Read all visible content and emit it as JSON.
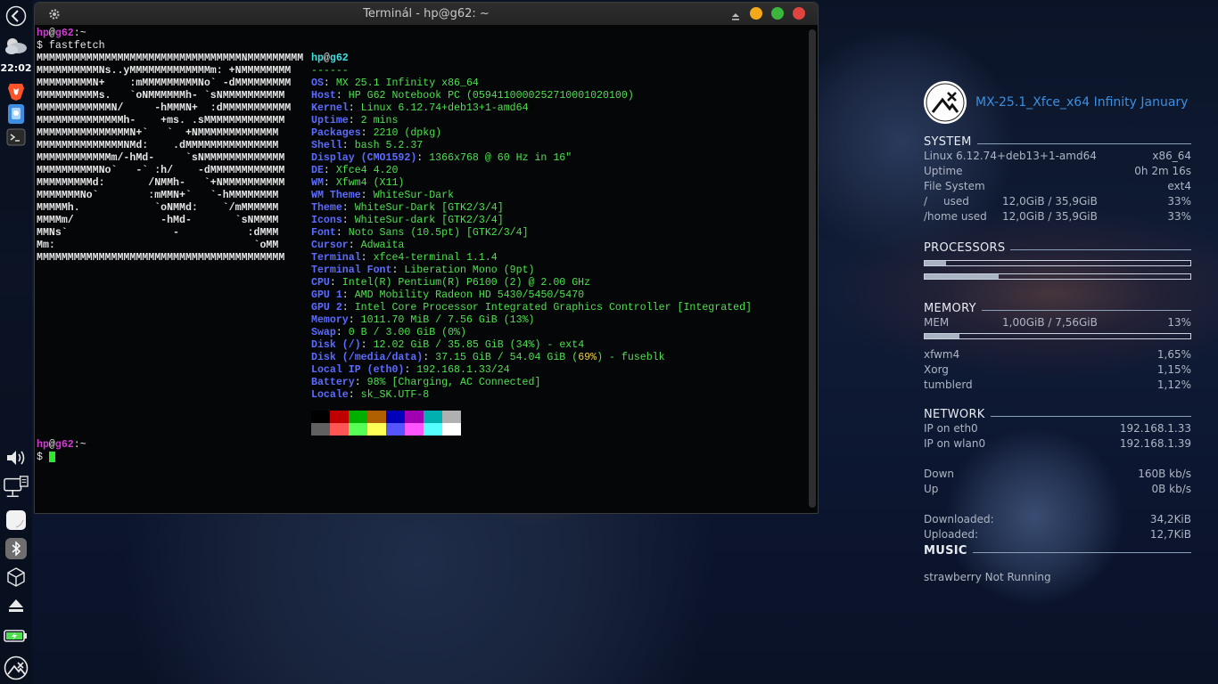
{
  "window": {
    "title": "Terminál - hp@g62: ~"
  },
  "panel": {
    "clock": "22:02"
  },
  "terminal": {
    "prompt1": {
      "user": "hp",
      "at": "@",
      "host": "g62",
      "path": ":~"
    },
    "command": "$ fastfetch",
    "logo_lines": [
      "MMMMMMMMMMMMMMMMMMMMMMMMMMMMMMMMMNMMMMMMMMM",
      "MMMMMMMMMMNs..yMMMMMMMMMMMMMm: +NMMMMMMMM",
      "MMMMMMMMMN+    :mMMMMMMMMMNo` -dMMMMMMMMM",
      "MMMMMMMMMMs.   `oNMMMMMMh- `sNMMMMMMMMMM",
      "MMMMMMMMMMMMN/     -hMMMN+  :dMMMMMMMMMMM",
      "MMMMMMMMMMMMMMh-    +ms. .sMMMMMMMMMMMMM",
      "MMMMMMMMMMMMMMMN+`   `  +NMMMMMMMMMMMMM",
      "MMMMMMMMMMMMMMNMd:    .dMMMMMMMMMMMMMMM",
      "MMMMMMMMMMMMm/-hMd-     `sNMMMMMMMMMMMMM",
      "MMMMMMMMMMNo`   -` :h/    -dMMMMMMMMMMMM",
      "MMMMMMMMMd:       /NMMh-   `+NMMMMMMMMMM",
      "MMMMMMMNo`        :mMMN+`   `-hMMMMMMMM",
      "MMMMMh.            `oNMMd:    `/mMMMMMM",
      "MMMMm/              -hMd-       `sNMMMM",
      "MMNs`                 -           :dMMM",
      "Mm:                                `oMM",
      "MMMMMMMMMMMMMMMMMMMMMMMMMMMMMMMMMMMMMMMM"
    ],
    "info_header": {
      "user": "hp",
      "at": "@",
      "host": "g62",
      "dashes": "------"
    },
    "info": [
      {
        "key": "OS",
        "val": "MX 25.1 Infinity x86_64"
      },
      {
        "key": "Host",
        "val": "HP G62 Notebook PC (0594110000252710001020100)"
      },
      {
        "key": "Kernel",
        "val": "Linux 6.12.74+deb13+1-amd64"
      },
      {
        "key": "Uptime",
        "val": "2 mins"
      },
      {
        "key": "Packages",
        "val": "2210 (dpkg)"
      },
      {
        "key": "Shell",
        "val": "bash 5.2.37"
      },
      {
        "key": "Display (CMO1592)",
        "val": "1366x768 @ 60 Hz in 16\""
      },
      {
        "key": "DE",
        "val": "Xfce4 4.20"
      },
      {
        "key": "WM",
        "val": "Xfwm4 (X11)"
      },
      {
        "key": "WM Theme",
        "val": "WhiteSur-Dark"
      },
      {
        "key": "Theme",
        "val": "WhiteSur-Dark [GTK2/3/4]"
      },
      {
        "key": "Icons",
        "val": "WhiteSur-dark [GTK2/3/4]"
      },
      {
        "key": "Font",
        "val": "Noto Sans (10.5pt) [GTK2/3/4]"
      },
      {
        "key": "Cursor",
        "val": "Adwaita"
      },
      {
        "key": "Terminal",
        "val": "xfce4-terminal 1.1.4"
      },
      {
        "key": "Terminal Font",
        "val": "Liberation Mono (9pt)"
      },
      {
        "key": "CPU",
        "val": "Intel(R) Pentium(R) P6100 (2) @ 2.00 GHz"
      },
      {
        "key": "GPU 1",
        "val": "AMD Mobility Radeon HD 5430/5450/5470"
      },
      {
        "key": "GPU 2",
        "val": "Intel Core Processor Integrated Graphics Controller [Integrated]"
      }
    ],
    "memory": {
      "key": "Memory",
      "val": "1011.70 MiB / 7.56 GiB (",
      "pct": "13%",
      "end": ")"
    },
    "swap": {
      "key": "Swap",
      "val": "0 B / 3.00 GiB (",
      "pct": "0%",
      "end": ")"
    },
    "disk1": {
      "key": "Disk (/)",
      "val": "12.02 GiB / 35.85 GiB (",
      "pct": "34%",
      "end": ") - ext4"
    },
    "disk2": {
      "key": "Disk (/media/data)",
      "val": "37.15 GiB / 54.04 GiB (",
      "pct": "69%",
      "end": ") - fuseblk"
    },
    "localip": {
      "key": "Local IP (eth0)",
      "val": "192.168.1.33/24"
    },
    "battery": {
      "key": "Battery",
      "pct": "98%",
      "val": " [Charging, AC Connected]"
    },
    "locale": {
      "key": "Locale",
      "val": "sk_SK.UTF-8"
    },
    "palette_top": [
      "#000000",
      "#c00000",
      "#00b000",
      "#b06000",
      "#0000b8",
      "#a000b0",
      "#00b0b0",
      "#b0b0b0"
    ],
    "palette_bottom": [
      "#606060",
      "#ff5555",
      "#55ff55",
      "#ffff55",
      "#5555ff",
      "#ff55ff",
      "#55ffff",
      "#ffffff"
    ],
    "prompt2": {
      "user": "hp",
      "at": "@",
      "host": "g62",
      "path": ":~",
      "dollar": "$ "
    }
  },
  "conky": {
    "title": "MX-25.1_Xfce_x64 Infinity January",
    "system": {
      "heading": "SYSTEM",
      "kernel": "Linux 6.12.74+deb13+1-amd64",
      "arch": "x86_64",
      "uptime_label": "Uptime",
      "uptime": "0h 2m 16s",
      "fs_label": "File System",
      "fs": "ext4",
      "root_label": "/",
      "root_used_label": "used",
      "root_used": "12,0GiB / 35,9GiB",
      "root_pct": "33%",
      "home_label": "/home used",
      "home_used": "12,0GiB / 35,9GiB",
      "home_pct": "33%"
    },
    "processors": {
      "heading": "PROCESSORS",
      "cpu1": 0.08,
      "cpu2": 0.28
    },
    "memory": {
      "heading": "MEMORY",
      "mem_label": "MEM",
      "mem": "1,00GiB / 7,56GiB",
      "mem_pct": "13%",
      "mem_fill": 0.13,
      "procs": [
        {
          "name": "xfwm4",
          "pct": "1,65%"
        },
        {
          "name": "Xorg",
          "pct": "1,15%"
        },
        {
          "name": "tumblerd",
          "pct": "1,12%"
        }
      ]
    },
    "network": {
      "heading": "NETWORK",
      "eth_label": "IP on eth0",
      "eth": "192.168.1.33",
      "wlan_label": "IP on wlan0",
      "wlan": "192.168.1.39",
      "down_label": "Down",
      "down": "160B kb/s",
      "up_label": "Up",
      "up": "0B kb/s",
      "downloaded_label": "Downloaded:",
      "downloaded": "34,2KiB",
      "uploaded_label": "Uploaded:",
      "uploaded": "12,7KiB"
    },
    "music": {
      "heading": "MUSIC",
      "status": "strawberry Not Running"
    }
  }
}
